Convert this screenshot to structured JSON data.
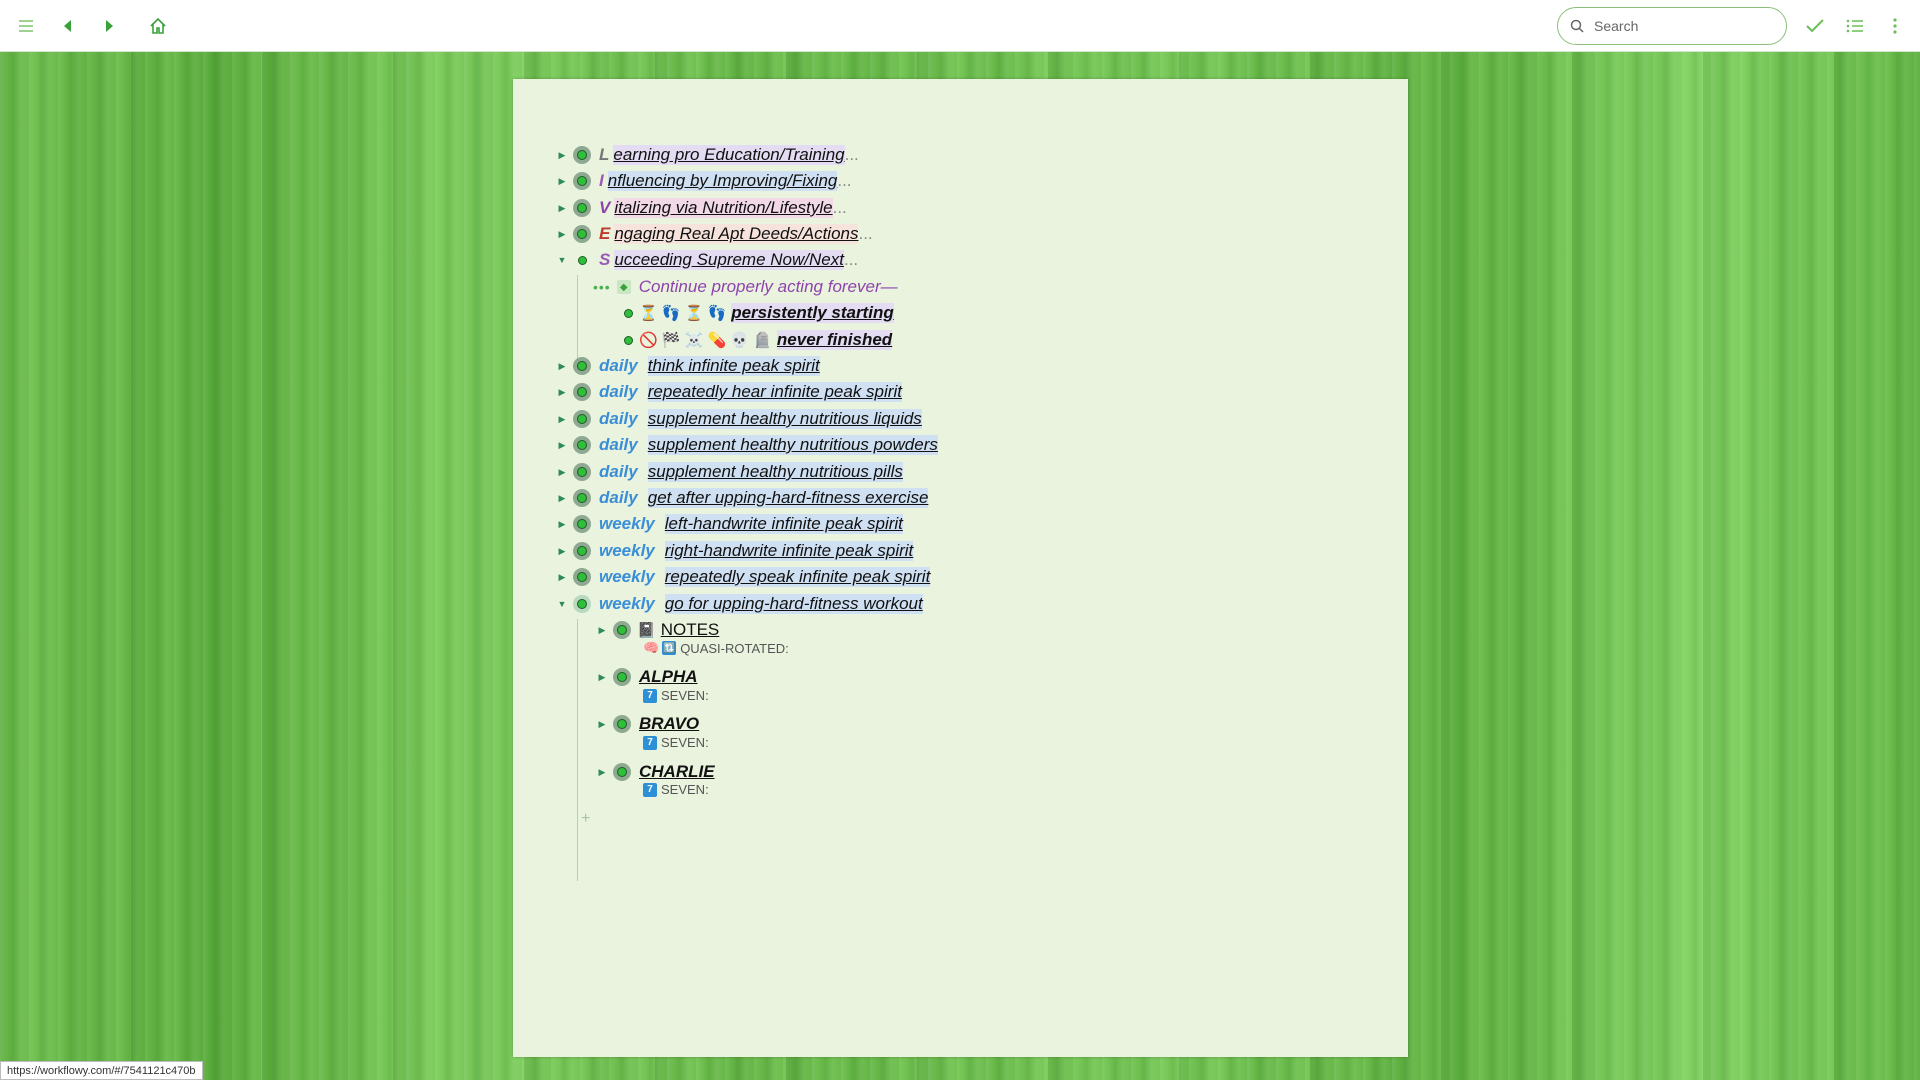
{
  "toolbar": {
    "search_placeholder": "Search"
  },
  "outline": {
    "items": [
      {
        "letter": "L",
        "text": "earning pro Education/Training",
        "ellipsis": "...",
        "color": "#777777"
      },
      {
        "letter": "I",
        "text": "nfluencing by Improving/Fixing",
        "ellipsis": "...",
        "color": "#9b59b6"
      },
      {
        "letter": "V",
        "text": "italizing via Nutrition/Lifestyle",
        "ellipsis": "...",
        "color": "#8e44ad"
      },
      {
        "letter": "E",
        "text": "ngaging Real Apt Deeds/Actions",
        "ellipsis": "...",
        "color": "#c0392b"
      },
      {
        "letter": "S",
        "text": "ucceeding Supreme Now/Next",
        "ellipsis": "...",
        "color": "#9b59b6"
      }
    ],
    "s_children": {
      "continue": "Continue properly acting forever—",
      "persist_icons": "⏳ 👣 ⏳ 👣",
      "persist": "persistently starting",
      "never_icons": "🚫 🏁 ☠️ 💊 💀 🪦",
      "never": "never finished"
    },
    "habits": [
      {
        "freq": "daily",
        "text": "think infinite peak spirit"
      },
      {
        "freq": "daily",
        "text": "repeatedly hear infinite peak spirit"
      },
      {
        "freq": "daily",
        "text": "supplement healthy nutritious liquids"
      },
      {
        "freq": "daily",
        "text": "supplement healthy nutritious powders"
      },
      {
        "freq": "daily",
        "text": "supplement healthy nutritious pills"
      },
      {
        "freq": "daily",
        "text": "get after upping-hard-fitness exercise"
      },
      {
        "freq": "weekly",
        "text": "left-handwrite infinite peak spirit"
      },
      {
        "freq": "weekly",
        "text": "right-handwrite infinite peak spirit"
      },
      {
        "freq": "weekly",
        "text": "repeatedly speak infinite peak spirit"
      },
      {
        "freq": "weekly",
        "text": "go for upping-hard-fitness workout"
      }
    ],
    "workout_children": [
      {
        "icon": "📓",
        "title": "NOTES",
        "note_icon": "🧠",
        "note_sq": "🔃",
        "note": "QUASI-ROTATED:"
      },
      {
        "title": "ALPHA",
        "note_sq": "7",
        "note": "SEVEN:"
      },
      {
        "title": "BRAVO",
        "note_sq": "7",
        "note": "SEVEN:"
      },
      {
        "title": "CHARLIE",
        "note_sq": "7",
        "note": "SEVEN:"
      }
    ],
    "add_symbol": "+"
  },
  "status_url": "https://workflowy.com/#/7541121c470b",
  "colors": {
    "accent": "#2e8b57",
    "tag_blue": "#3a8ed8",
    "continue_purple": "#8e44ad"
  }
}
